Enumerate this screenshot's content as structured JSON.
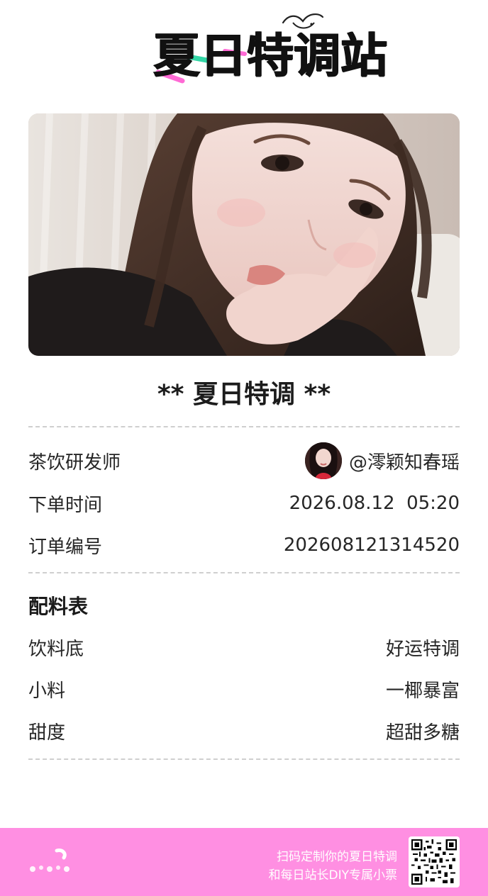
{
  "header": {
    "logo_text": "夏日特调站"
  },
  "ticket": {
    "title": "** 夏日特调 **",
    "rows": [
      {
        "label": "茶饮研发师",
        "value": "@澪颖知春瑶"
      },
      {
        "label": "下单时间",
        "value": "2026.08.12  05:20"
      },
      {
        "label": "订单编号",
        "value": "202608121314520"
      }
    ]
  },
  "recipe": {
    "title": "配料表",
    "rows": [
      {
        "label": "饮料底",
        "value": "好运特调"
      },
      {
        "label": "小料",
        "value": "一椰暴富"
      },
      {
        "label": "甜度",
        "value": "超甜多糖"
      }
    ]
  },
  "footer": {
    "line1": "扫码定制你的夏日特调",
    "line2": "和每日站长DIY专属小票"
  },
  "colors": {
    "footer_bg": "#ff8fe2",
    "logo_pink": "#ff6ad5",
    "logo_green": "#33d6a6",
    "divider": "#cfcfcf"
  },
  "icons": {
    "logo": "summer-special-logo",
    "bird": "seagull-icon",
    "qr": "qr-code-icon",
    "avatar": "designer-avatar"
  }
}
